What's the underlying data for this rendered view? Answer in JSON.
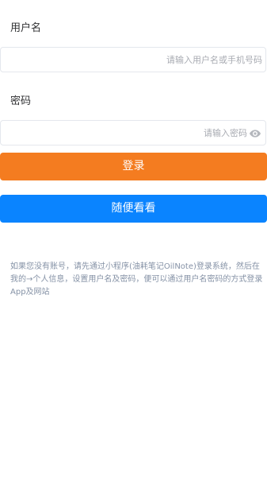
{
  "colors": {
    "login_button": "#f47c20",
    "browse_button": "#0a84ff",
    "hint_text": "#8592a6"
  },
  "username": {
    "label": "用户名",
    "value": "",
    "placeholder": "请输入用户名或手机号码"
  },
  "password": {
    "label": "密码",
    "value": "",
    "placeholder": "请输入密码",
    "toggle_icon": "eye-icon"
  },
  "buttons": {
    "login_label": "登录",
    "browse_label": "随便看看"
  },
  "hint": {
    "text": "如果您没有账号，请先通过小程序(油耗笔记OilNote)登录系统，然后在我的→个人信息，设置用户名及密码，便可以通过用户名密码的方式登录App及网站"
  }
}
